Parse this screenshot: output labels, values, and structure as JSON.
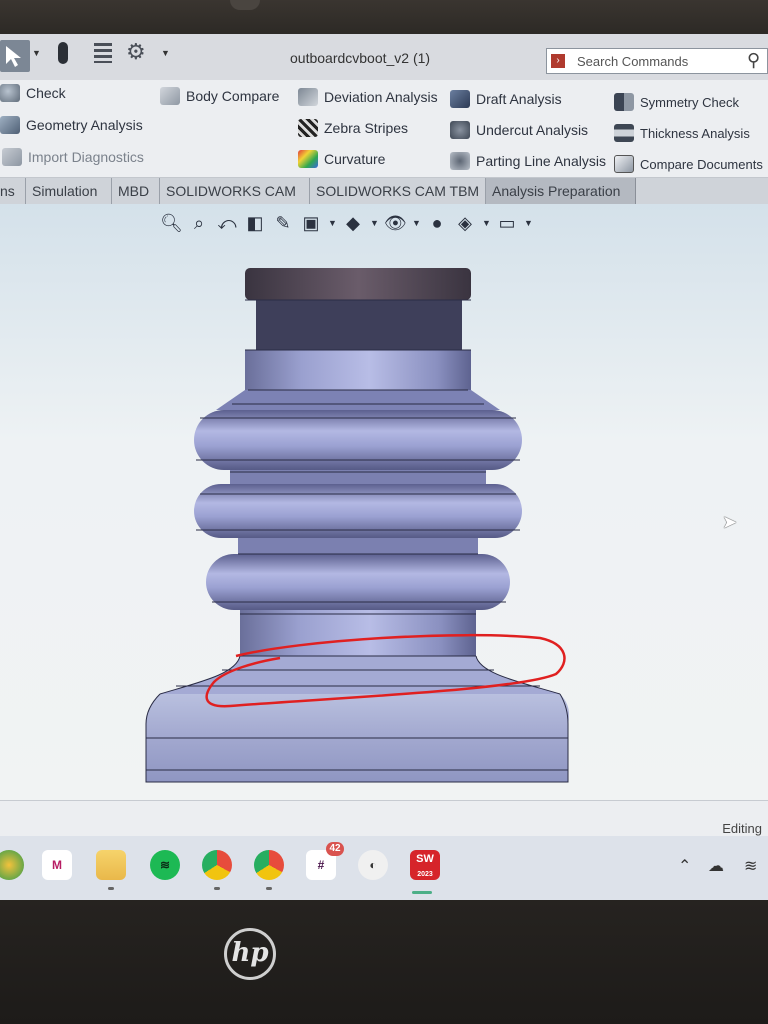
{
  "window": {
    "title": "outboardcvboot_v2 (1)",
    "search_placeholder": "Search Commands"
  },
  "ribbon": {
    "col1": [
      {
        "label": "Check",
        "icon": "check-icon",
        "enabled": true
      },
      {
        "label": "Geometry Analysis",
        "icon": "geometry-analysis-icon",
        "enabled": true
      },
      {
        "label": "Import Diagnostics",
        "icon": "import-diagnostics-icon",
        "enabled": false
      }
    ],
    "col2": [
      {
        "label": "Body Compare",
        "icon": "body-compare-icon",
        "enabled": true
      }
    ],
    "col3": [
      {
        "label": "Deviation Analysis",
        "icon": "deviation-analysis-icon",
        "enabled": true
      },
      {
        "label": "Zebra Stripes",
        "icon": "zebra-stripes-icon",
        "enabled": true
      },
      {
        "label": "Curvature",
        "icon": "curvature-icon",
        "enabled": true
      }
    ],
    "col4": [
      {
        "label": "Draft Analysis",
        "icon": "draft-analysis-icon",
        "enabled": true
      },
      {
        "label": "Undercut Analysis",
        "icon": "undercut-analysis-icon",
        "enabled": true
      },
      {
        "label": "Parting Line Analysis",
        "icon": "parting-line-analysis-icon",
        "enabled": true
      }
    ],
    "col5": [
      {
        "label": "Symmetry Check",
        "icon": "symmetry-check-icon",
        "enabled": true
      },
      {
        "label": "Thickness Analysis",
        "icon": "thickness-analysis-icon",
        "enabled": true
      },
      {
        "label": "Compare Documents",
        "icon": "compare-documents-icon",
        "enabled": true
      }
    ]
  },
  "tabs": [
    {
      "label": "ns",
      "active": false
    },
    {
      "label": "Simulation",
      "active": false
    },
    {
      "label": "MBD",
      "active": false
    },
    {
      "label": "SOLIDWORKS CAM",
      "active": false
    },
    {
      "label": "SOLIDWORKS CAM TBM",
      "active": false
    },
    {
      "label": "Analysis Preparation",
      "active": true
    }
  ],
  "status": {
    "mode": "Editing"
  },
  "taskbar": {
    "apps": [
      {
        "name": "chrome-profile-icon",
        "badge": ""
      },
      {
        "name": "mcafee-icon",
        "badge": ""
      },
      {
        "name": "file-explorer-icon",
        "badge": ""
      },
      {
        "name": "spotify-icon",
        "badge": ""
      },
      {
        "name": "chrome-icon",
        "badge": ""
      },
      {
        "name": "chrome-t-icon",
        "badge": ""
      },
      {
        "name": "slack-icon",
        "badge": "42"
      },
      {
        "name": "obs-icon",
        "badge": ""
      },
      {
        "name": "solidworks-icon",
        "badge": ""
      }
    ],
    "sw_label": "SW",
    "sw_year": "2023"
  },
  "colors": {
    "model_fill": "#8e95c6",
    "annotation": "#e02020",
    "viewport_bg": "#e9eef2"
  },
  "brand": {
    "logo_text": "hp"
  }
}
